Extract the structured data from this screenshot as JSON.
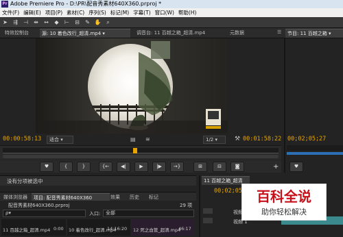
{
  "window": {
    "title": "Adobe Premiere Pro - D:\\PR\\配音秀素材640X360.prproj *",
    "app_icon": "Pr"
  },
  "menu": [
    "文件(F)",
    "编辑(E)",
    "项目(P)",
    "素材(C)",
    "序列(S)",
    "标记(M)",
    "字幕(T)",
    "窗口(W)",
    "帮助(H)"
  ],
  "toolbar_icons": [
    "selection-icon",
    "track-select-icon",
    "ripple-edit-icon",
    "rolling-edit-icon",
    "rate-stretch-icon",
    "razor-icon",
    "slip-icon",
    "slide-icon",
    "pen-icon",
    "hand-icon",
    "zoom-icon"
  ],
  "tabs": {
    "effect_controls": "特效控制台",
    "source": "源: 10 着色改行_超清.mp4 ▾",
    "mixer": "调音台: 11 百越之箱_超清.mp4",
    "metadata": "元数据",
    "program": "节目: 11 百越之箱 ▾"
  },
  "source_monitor": {
    "timecode_in": "00:00:58:13",
    "fit_label": "适合",
    "duration": "00:01:58:22",
    "resolution": "1/2",
    "playhead_fraction": 0.48
  },
  "program_monitor": {
    "timecode": "00;02;05;27"
  },
  "transport_buttons": [
    "marker-icon",
    "mark-in-icon",
    "mark-out-icon",
    "go-to-in-icon",
    "step-back-icon",
    "play-icon",
    "step-forward-icon",
    "go-to-out-icon",
    "insert-icon",
    "overwrite-icon",
    "export-frame-icon"
  ],
  "status": {
    "no_selection": "没有分项被选中"
  },
  "project_tabs": {
    "browser": "媒体浏览器",
    "project": "项目: 配音秀素材640X360",
    "effects": "效果",
    "history": "历史",
    "markers": "标记"
  },
  "project_panel": {
    "project_name": "配音秀素材640X360.prproj",
    "item_count": "29 项",
    "search_placeholder": "ρ▾",
    "entry_label": "入口:",
    "entry_value": "全部",
    "clip1_name": "11 百越之箱_超清.mp4",
    "clip1_dur": "0:00",
    "clip2_name": "10 着色改行_超清.mp4",
    "clip2_dur": "14:16:20",
    "clip3_name": "12 死之血管_超清.mp4",
    "clip3_dur": "46:17"
  },
  "timeline": {
    "tab": "11 百越之箱_超清",
    "timecode": "00;02;05;2",
    "track_v2": "视频 2",
    "track_v1": "视频 1"
  },
  "watermark": {
    "title": "百科全说",
    "subtitle": "助你轻松解决"
  },
  "colors": {
    "timecode_orange": "#e8a500",
    "panel_bg": "#232323",
    "accent_blue": "#2c6fb5",
    "watermark_red": "#c8101a",
    "timeline_teal": "#3b8a8e"
  }
}
